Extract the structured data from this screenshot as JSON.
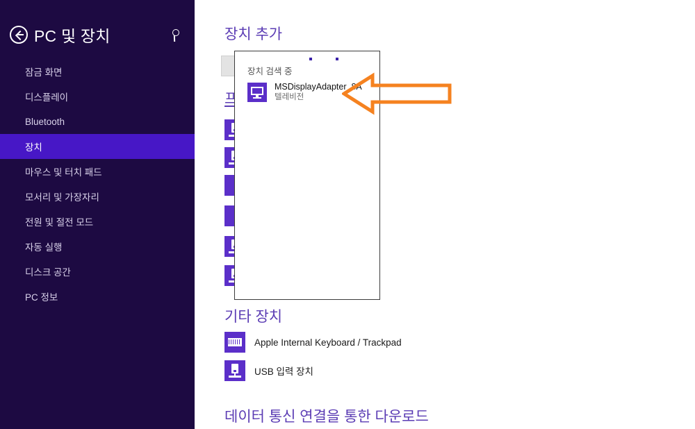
{
  "sidebar": {
    "back_icon": "back-arrow-icon",
    "title": "PC 및 장치",
    "search_icon": "search-icon",
    "items": [
      {
        "label": "잠금 화면",
        "selected": false
      },
      {
        "label": "디스플레이",
        "selected": false
      },
      {
        "label": "Bluetooth",
        "selected": false
      },
      {
        "label": "장치",
        "selected": true
      },
      {
        "label": "마우스 및 터치 패드",
        "selected": false
      },
      {
        "label": "모서리 및 가장자리",
        "selected": false
      },
      {
        "label": "전원 및 절전 모드",
        "selected": false
      },
      {
        "label": "자동 실행",
        "selected": false
      },
      {
        "label": "디스크 공간",
        "selected": false
      },
      {
        "label": "PC 정보",
        "selected": false
      }
    ],
    "colors": {
      "background": "#1d0a42",
      "selected_background": "#4717c6",
      "text": "#d9d2ea",
      "selected_text": "#ffffff"
    }
  },
  "main": {
    "headings": {
      "add_device": "장치 추가",
      "printers": "프린터",
      "other_devices": "기타 장치",
      "metered_download": "데이터 통신 연결을 통한 다운로드"
    },
    "heading_color": "#5b3cb4",
    "other_devices": [
      {
        "icon": "keyboard-icon",
        "label": "Apple Internal Keyboard / Trackpad"
      },
      {
        "icon": "usb-device-icon",
        "label": "USB 입력 장치"
      }
    ]
  },
  "flyout": {
    "status": "장치 검색 중",
    "progress_dots": 2,
    "device": {
      "icon": "monitor-icon",
      "name": "MSDisplayAdapter_8A",
      "kind": "텔레비전"
    },
    "border_color": "#3b3b3b",
    "dot_color": "#3a21a8"
  },
  "annotation": {
    "arrow_name": "left-pointing-callout-arrow",
    "color": "#f58220",
    "direction": "left"
  }
}
